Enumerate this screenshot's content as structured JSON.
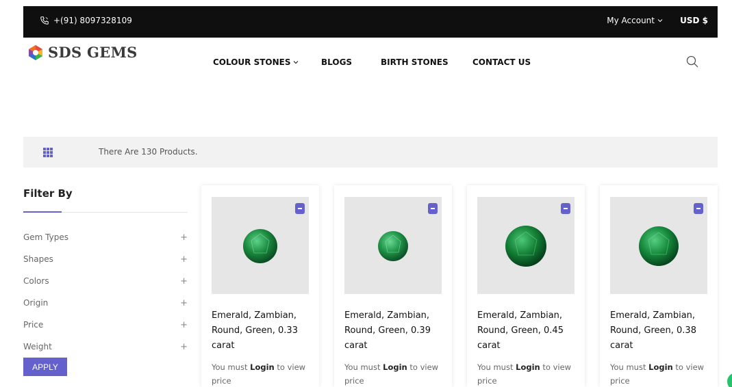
{
  "topbar": {
    "phone": "+(91) 8097328109",
    "account": "My Account",
    "currency": "USD $"
  },
  "logo": {
    "text": "SDS GEMS"
  },
  "nav": [
    {
      "label": "COLOUR STONES"
    },
    {
      "label": "BLOGS"
    },
    {
      "label": "BIRTH STONES"
    },
    {
      "label": "CONTACT US"
    }
  ],
  "listing": {
    "count_text": "There Are 130 Products."
  },
  "filter": {
    "heading": "Filter By",
    "items": [
      {
        "label": "Gem Types"
      },
      {
        "label": "Shapes"
      },
      {
        "label": "Colors"
      },
      {
        "label": "Origin"
      },
      {
        "label": "Price"
      },
      {
        "label": "Weight"
      }
    ],
    "apply_label": "APPLY"
  },
  "products": [
    {
      "title": "Emerald, Zambian, Round, Green, 0.33 carat",
      "price_prefix": "You must ",
      "price_link": "Login",
      "price_suffix": " to view price"
    },
    {
      "title": "Emerald, Zambian, Round, Green, 0.39 carat",
      "price_prefix": "You must ",
      "price_link": "Login",
      "price_suffix": " to view price"
    },
    {
      "title": "Emerald, Zambian, Round, Green, 0.45 carat",
      "price_prefix": "You must ",
      "price_link": "Login",
      "price_suffix": " to view price"
    },
    {
      "title": "Emerald, Zambian, Round, Green, 0.38 carat",
      "price_prefix": "You must ",
      "price_link": "Login",
      "price_suffix": " to view price"
    }
  ],
  "colors": {
    "accent": "#6460cc",
    "topbar": "#0f0f0f",
    "emerald": "#1a8a3e"
  },
  "icons": [
    "phone-icon",
    "chevron-down-icon",
    "search-icon",
    "grid-view-icon",
    "plus-icon",
    "remove-icon",
    "chat-icon"
  ]
}
